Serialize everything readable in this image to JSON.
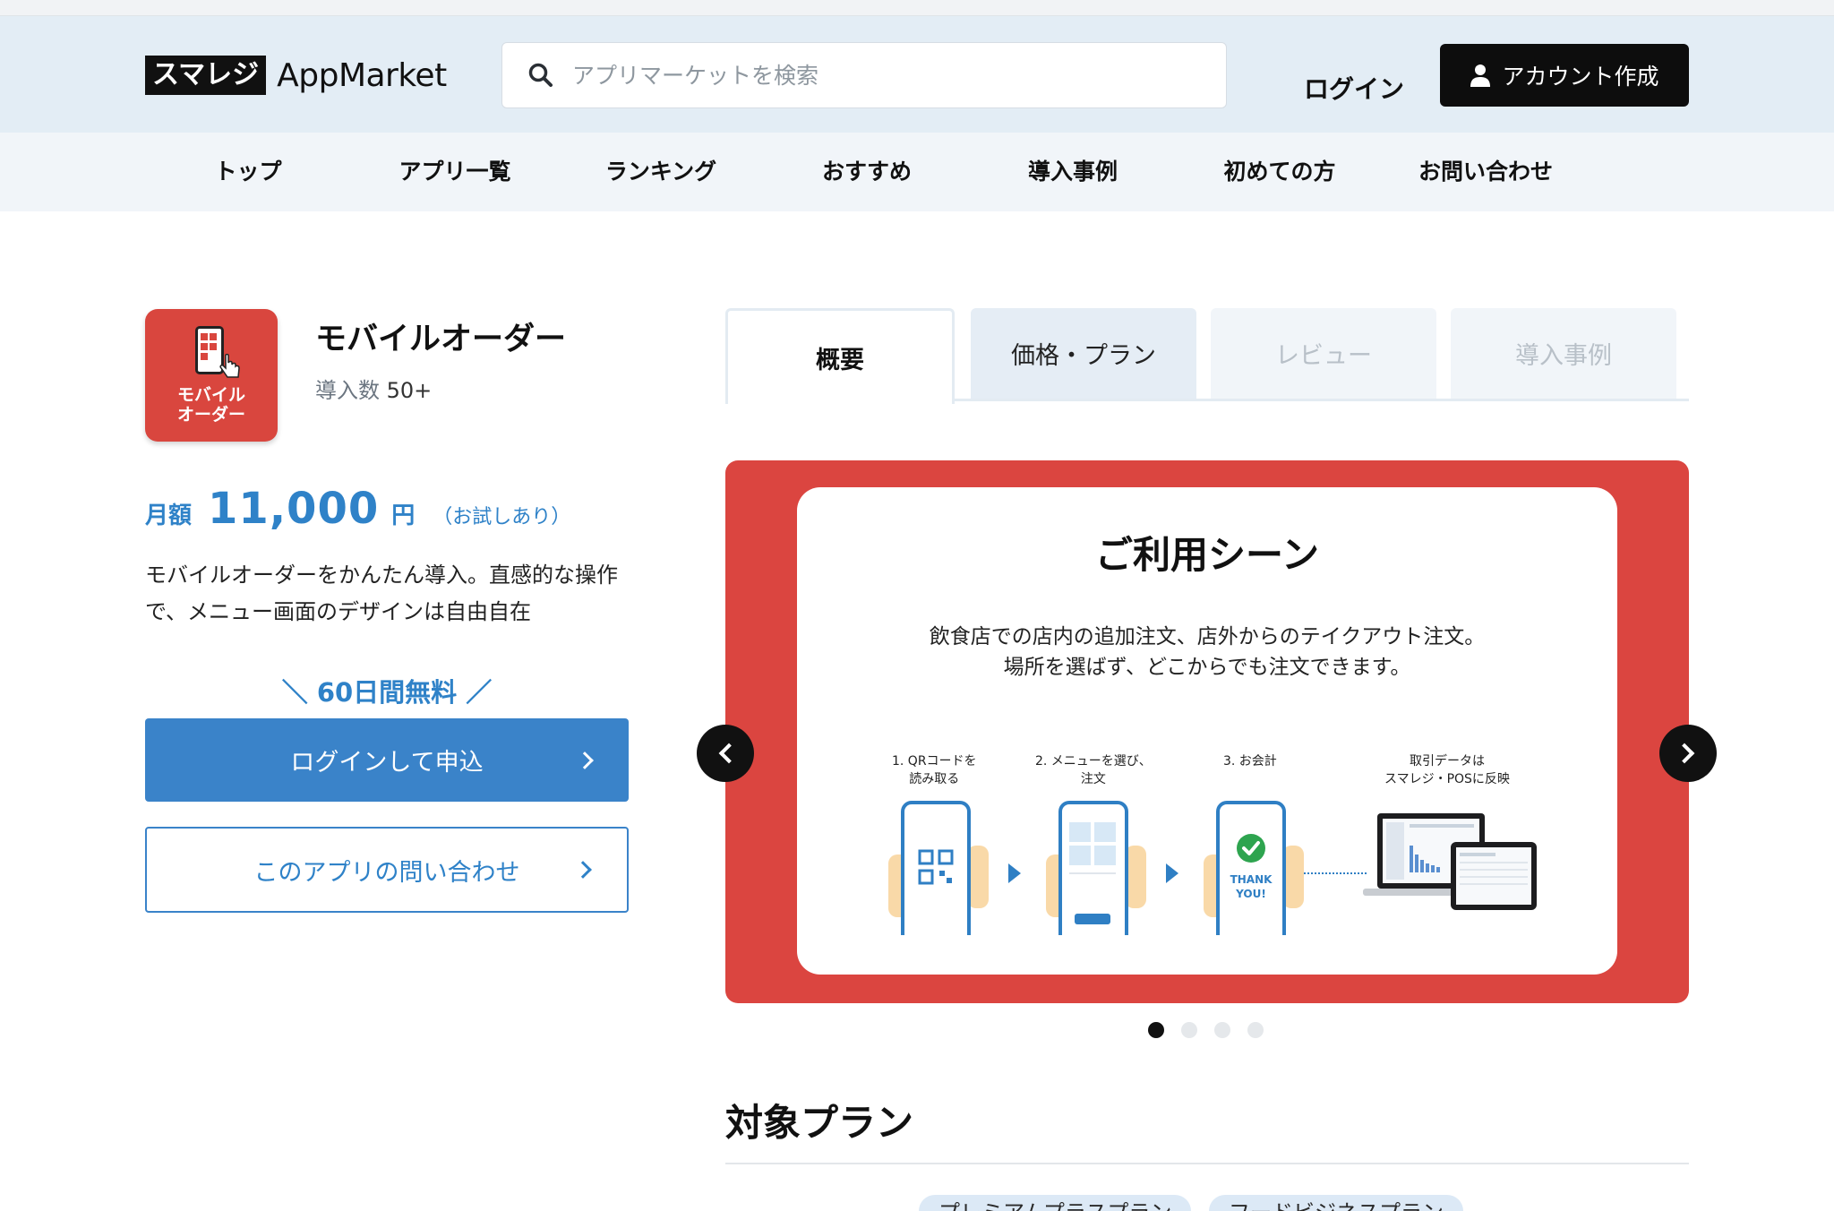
{
  "header": {
    "logo_badge": "スマレジ",
    "logo_text": "AppMarket",
    "search_placeholder": "アプリマーケットを検索",
    "login_label": "ログイン",
    "account_label": "アカウント作成"
  },
  "nav": {
    "items": [
      "トップ",
      "アプリ一覧",
      "ランキング",
      "おすすめ",
      "導入事例",
      "初めての方",
      "お問い合わせ"
    ]
  },
  "app": {
    "icon_label_line1": "モバイル",
    "icon_label_line2": "オーダー",
    "name": "モバイルオーダー",
    "installs_label": "導入数",
    "installs_value": "50+",
    "price_label": "月額",
    "price_amount": "11,000",
    "price_unit": "円",
    "price_trial": "（お試しあり）",
    "description": "モバイルオーダーをかんたん導入。直感的な操作で、メニュー画面のデザインは自由自在",
    "free_period": "＼ 60日間無料 ／",
    "apply_button": "ログインして申込",
    "inquiry_button": "このアプリの問い合わせ"
  },
  "tabs": [
    {
      "label": "概要",
      "state": "active"
    },
    {
      "label": "価格・プラン",
      "state": "normal"
    },
    {
      "label": "レビュー",
      "state": "disabled"
    },
    {
      "label": "導入事例",
      "state": "disabled"
    }
  ],
  "carousel": {
    "title": "ご利用シーン",
    "text_line1": "飲食店での店内の追加注文、店外からのテイクアウト注文。",
    "text_line2": "場所を選ばず、どこからでも注文できます。",
    "steps": [
      {
        "line1": "1. QRコードを",
        "line2": "読み取る"
      },
      {
        "line1": "2. メニューを選び、",
        "line2": "注文"
      },
      {
        "line1": "3. お会計",
        "line2": ""
      },
      {
        "line1": "取引データは",
        "line2": "スマレジ・POSに反映"
      }
    ],
    "thank_you_line1": "THANK",
    "thank_you_line2": "YOU!",
    "slide_count": 4,
    "active_slide": 1,
    "accent_color": "#db4540"
  },
  "plans": {
    "title": "対象プラン",
    "chips": [
      "プレミアムプラスプラン",
      "フードビジネスプラン"
    ]
  },
  "colors": {
    "brand_blue": "#3a83c9",
    "header_bg": "#e3edf5",
    "nav_bg": "#f1f5f9"
  },
  "icons": {
    "search": "search-icon",
    "user": "user-icon",
    "prev": "chevron-left-icon",
    "next": "chevron-right-icon"
  }
}
